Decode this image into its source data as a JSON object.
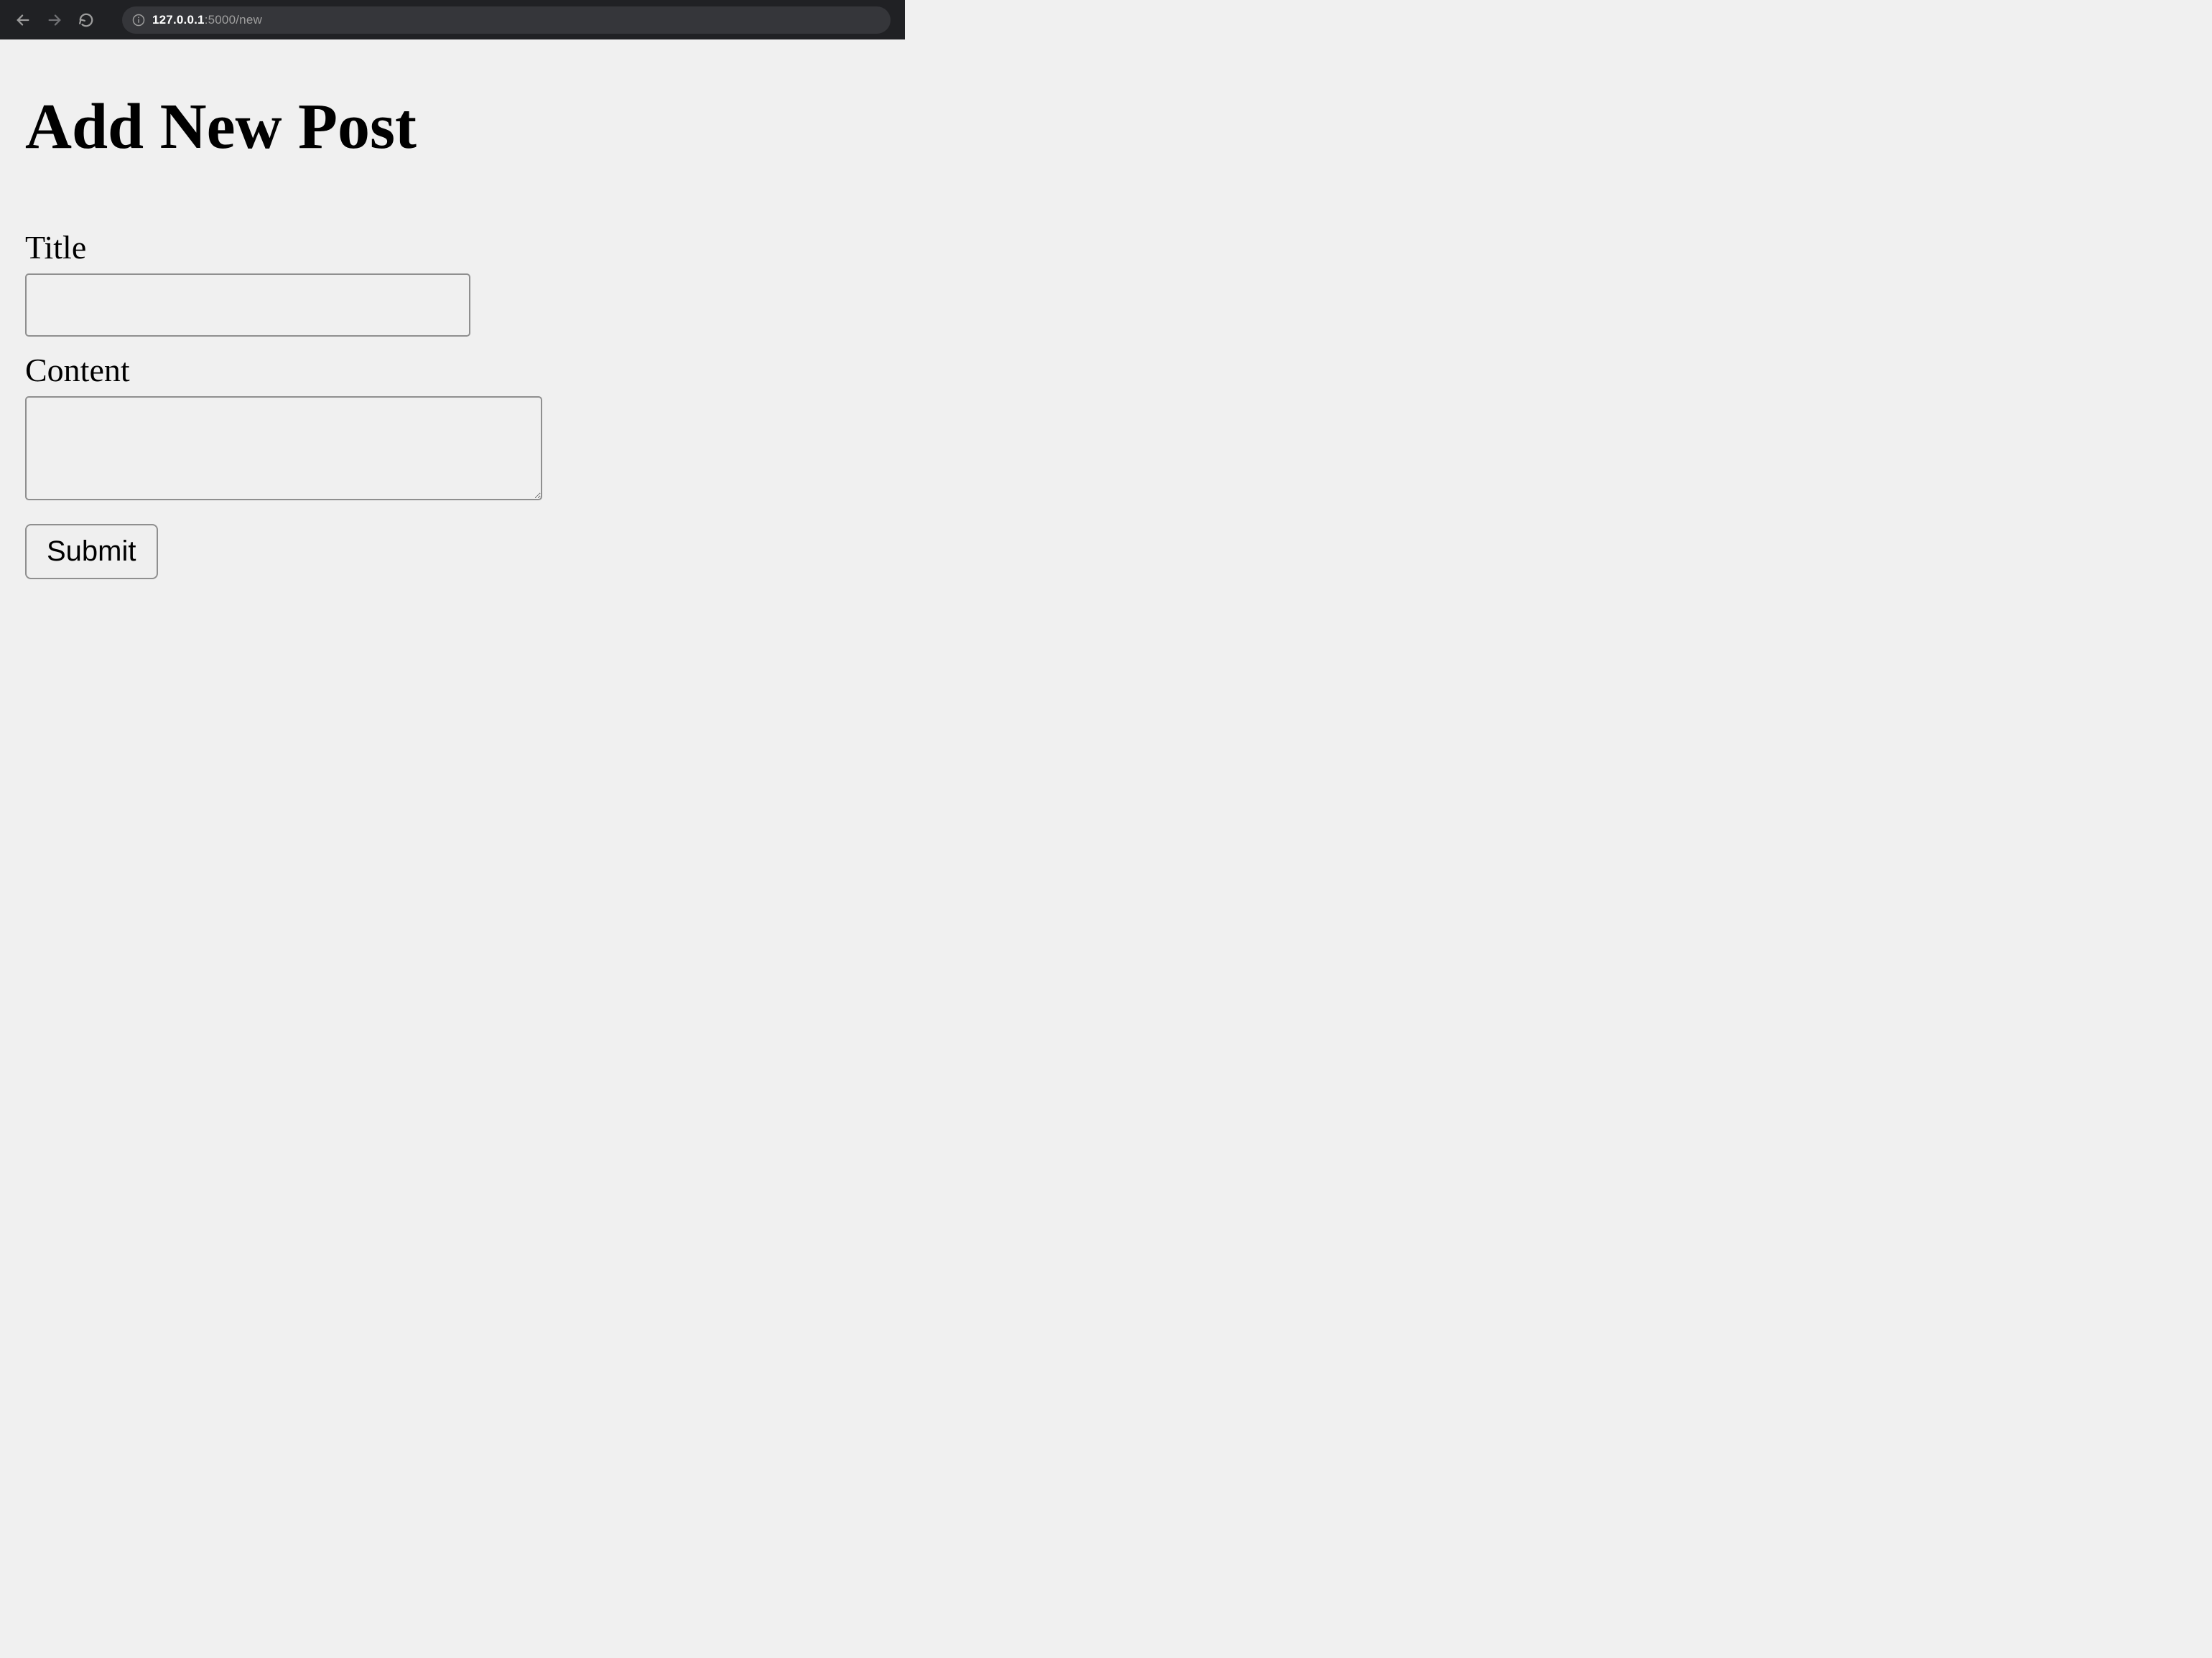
{
  "browser": {
    "url_host": "127.0.0.1",
    "url_port_path": ":5000/new"
  },
  "page": {
    "heading": "Add New Post"
  },
  "form": {
    "title_label": "Title",
    "title_value": "",
    "content_label": "Content",
    "content_value": "",
    "submit_label": "Submit"
  }
}
